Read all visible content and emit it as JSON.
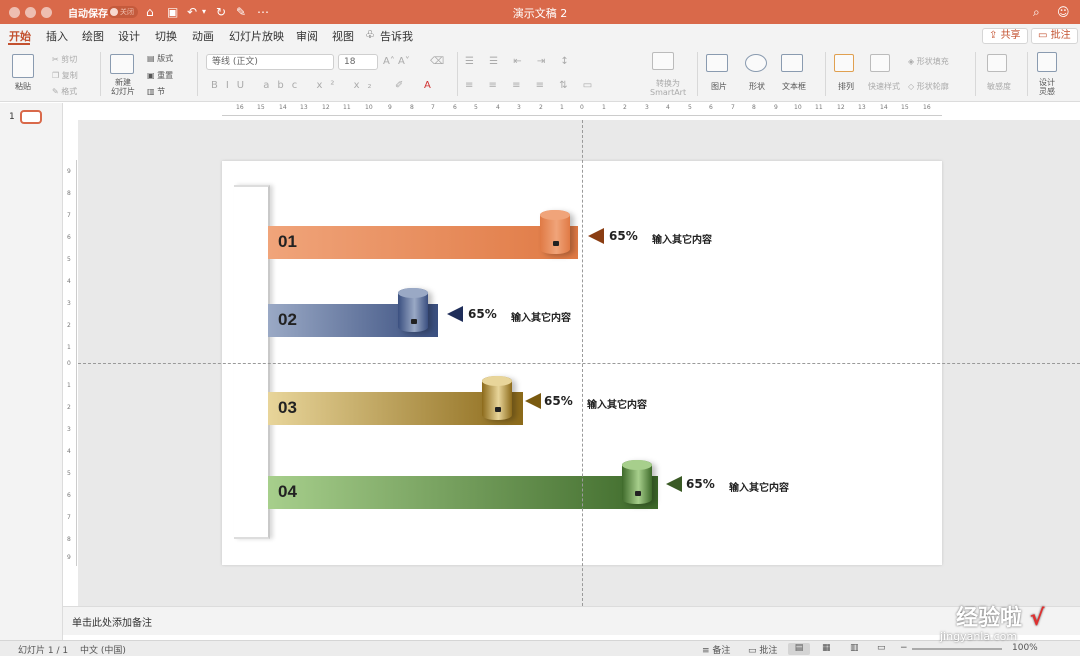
{
  "titlebar": {
    "autosave": "自动保存",
    "toggle_state": "关闭",
    "doc_title": "演示文稿 2",
    "icons": [
      "home-icon",
      "save-icon",
      "undo-icon",
      "redo-icon",
      "edit-icon",
      "more-icon",
      "search-icon",
      "smiley-icon"
    ],
    "color": "#d9694a"
  },
  "tabs": [
    {
      "label": "开始",
      "active": true
    },
    {
      "label": "插入"
    },
    {
      "label": "绘图"
    },
    {
      "label": "设计"
    },
    {
      "label": "切换"
    },
    {
      "label": "动画"
    },
    {
      "label": "幻灯片放映"
    },
    {
      "label": "审阅"
    },
    {
      "label": "视图"
    },
    {
      "label": "告诉我"
    }
  ],
  "share": "共享",
  "comments": "批注",
  "ribbon": {
    "paste": "粘贴",
    "cut": "剪切",
    "copy": "复制",
    "format": "格式",
    "new_slide": [
      "新建",
      "幻灯片"
    ],
    "layout": "版式",
    "reset": "重置",
    "section": "节",
    "font_name": "等线 (正文)",
    "font_size": "18",
    "convert_smartart": [
      "转换为",
      "SmartArt"
    ],
    "picture": "图片",
    "shapes": "形状",
    "textbox": "文本框",
    "arrange": "排列",
    "quick_styles": "快速样式",
    "shape_fill": "形状填充",
    "shape_outline": "形状轮廓",
    "sensitivity": "敏感度",
    "designer": [
      "设计",
      "灵感"
    ]
  },
  "slide_panel": {
    "number": "1"
  },
  "hruler_labels": [
    "16",
    "15",
    "14",
    "13",
    "12",
    "11",
    "10",
    "9",
    "8",
    "7",
    "6",
    "5",
    "4",
    "3",
    "2",
    "1",
    "0",
    "1",
    "2",
    "3",
    "4",
    "5",
    "6",
    "7",
    "8",
    "9",
    "10",
    "11",
    "12",
    "13",
    "14",
    "15",
    "16"
  ],
  "vruler_labels": [
    "9",
    "8",
    "7",
    "6",
    "5",
    "4",
    "3",
    "2",
    "1",
    "0",
    "1",
    "2",
    "3",
    "4",
    "5",
    "6",
    "7",
    "8",
    "9"
  ],
  "rows": [
    {
      "num": "01",
      "pct": "65%",
      "text": "输入其它内容",
      "color": "#e07a45",
      "start_color": "#f0a47a",
      "tri_color": "#8a3d12"
    },
    {
      "num": "02",
      "pct": "65%",
      "text": "输入其它内容",
      "color": "#3a4f80",
      "start_color": "#9aa9c5",
      "tri_color": "#1f2e5a"
    },
    {
      "num": "03",
      "pct": "65%",
      "text": "输入其它内容",
      "color": "#8c6a1a",
      "start_color": "#e8d59a",
      "tri_color": "#7a5a10"
    },
    {
      "num": "04",
      "pct": "65%",
      "text": "输入其它内容",
      "color": "#3e6a2a",
      "start_color": "#a7cf8c",
      "tri_color": "#3a5a25"
    }
  ],
  "notes": "单击此处添加备注",
  "status": {
    "slide": "幻灯片 1 / 1",
    "lang": "中文 (中国)",
    "notes": "备注",
    "comments": "批注",
    "zoom": "100%"
  },
  "watermark": {
    "main": "经验啦",
    "check": "√",
    "url": "jingyanla.com"
  }
}
